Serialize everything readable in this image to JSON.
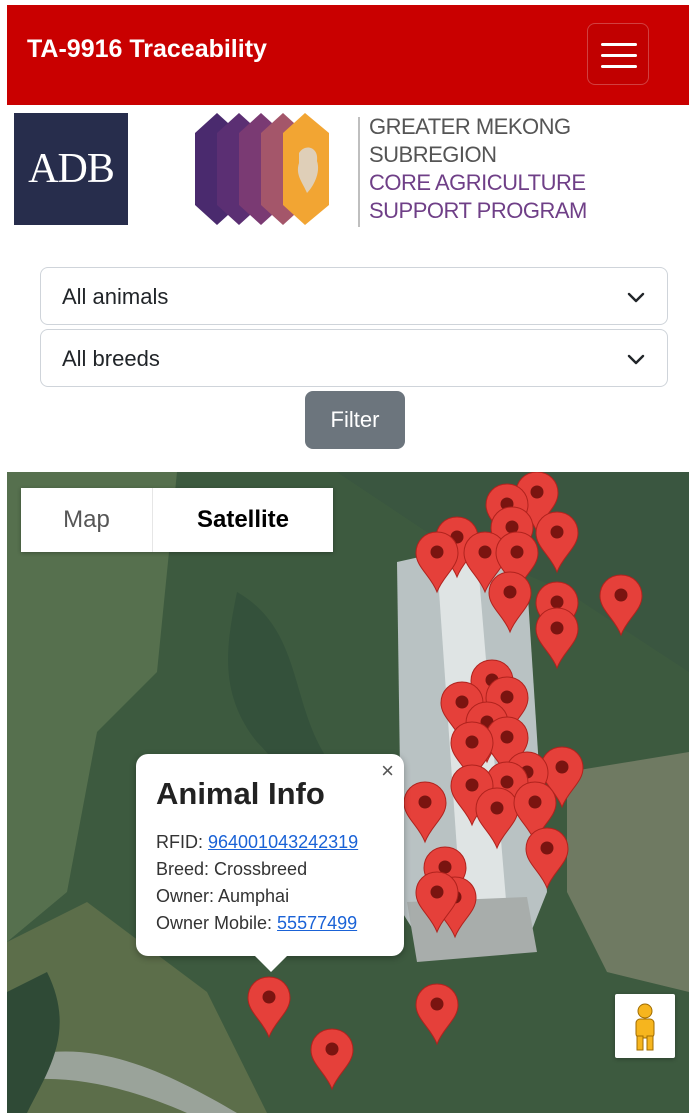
{
  "navbar": {
    "brand": "TA-9916 Traceability",
    "menu_icon": "hamburger-menu-icon"
  },
  "logos": {
    "adb_text": "ADB",
    "gms_lines": [
      "GREATER MEKONG",
      "SUBREGION",
      "CORE AGRICULTURE",
      "SUPPORT PROGRAM"
    ]
  },
  "filters": {
    "animal_select": "All animals",
    "breed_select": "All breeds",
    "filter_button": "Filter"
  },
  "map": {
    "type_map": "Map",
    "type_satellite": "Satellite",
    "selected_type": "Satellite",
    "marker_icon": "map-pin-icon",
    "pegman_icon": "street-view-pegman-icon",
    "info": {
      "title": "Animal Info",
      "rfid_label": "RFID: ",
      "rfid_value": "964001043242319",
      "breed_line": "Breed: Crossbreed",
      "owner_line": "Owner: Aumphai",
      "mobile_label": "Owner Mobile: ",
      "mobile_value": "55577499",
      "close": "×"
    }
  },
  "colors": {
    "navbar": "#c90000",
    "marker": "#e5403a",
    "button": "#6c757d",
    "link": "#1a62d6"
  }
}
